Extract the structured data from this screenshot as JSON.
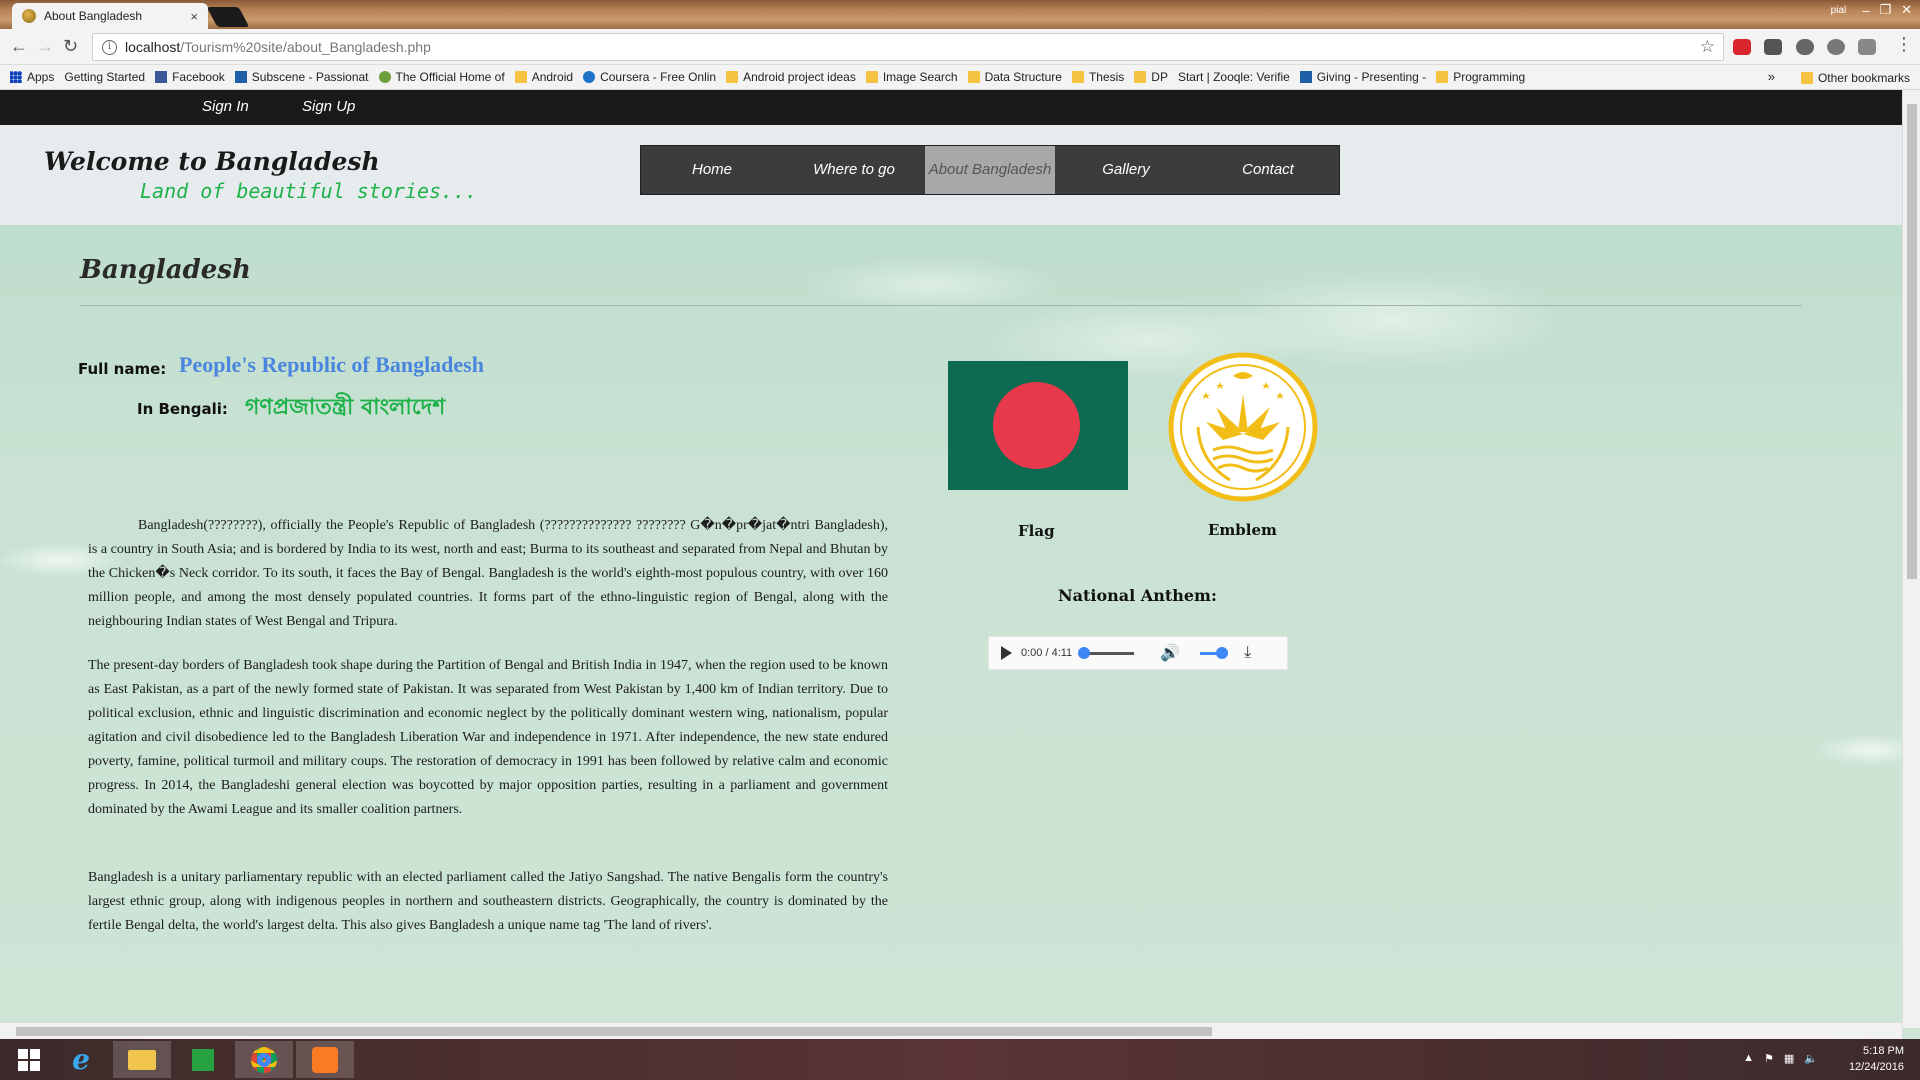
{
  "browser": {
    "tab_title": "About Bangladesh",
    "tab_close": "×",
    "profile": "pial",
    "window_controls": [
      "–",
      "❐",
      "✕"
    ],
    "url_host": "localhost",
    "url_path": "/Tourism%20site/about_Bangladesh.php",
    "bookmarks": [
      {
        "label": "Apps",
        "icon": "grid"
      },
      {
        "label": "Getting Started",
        "icon": "page"
      },
      {
        "label": "Facebook",
        "icon": "fb"
      },
      {
        "label": "Subscene - Passionat",
        "icon": "s"
      },
      {
        "label": "The Official Home of",
        "icon": "gen"
      },
      {
        "label": "Android",
        "icon": "folder"
      },
      {
        "label": "Coursera - Free Onlin",
        "icon": "co"
      },
      {
        "label": "Android project ideas",
        "icon": "folder"
      },
      {
        "label": "Image Search",
        "icon": "folder"
      },
      {
        "label": "Data Structure",
        "icon": "folder"
      },
      {
        "label": "Thesis",
        "icon": "folder"
      },
      {
        "label": "DP",
        "icon": "folder"
      },
      {
        "label": "Start | Zooqle: Verifie",
        "icon": "page"
      },
      {
        "label": "Giving - Presenting -",
        "icon": "s"
      },
      {
        "label": "Programming",
        "icon": "folder"
      }
    ],
    "more_bookmarks": "»",
    "other_bookmarks": "Other bookmarks"
  },
  "site": {
    "auth": {
      "sign_in": "Sign In",
      "sign_up": "Sign Up"
    },
    "title": "Welcome to Bangladesh",
    "tagline": "Land of beautiful stories...",
    "nav": [
      {
        "label": "Home",
        "active": false
      },
      {
        "label": "Where to go",
        "active": false
      },
      {
        "label": "About Bangladesh",
        "active": true
      },
      {
        "label": "Gallery",
        "active": false
      },
      {
        "label": "Contact",
        "active": false
      }
    ]
  },
  "content": {
    "heading": "Bangladesh",
    "full_name_label": "Full name:",
    "full_name": "People's Republic of Bangladesh",
    "bengali_label": "In Bengali:",
    "bengali_name": "গণপ্রজাতন্ত্রী বাংলাদেশ",
    "paragraphs": [
      "Bangladesh(????????), officially the People's Republic of Bangladesh (?????????????? ???????? G�n�pr�jat�ntri Bangladesh), is a country in South Asia; and is bordered by India to its west, north and east; Burma to its southeast and separated from Nepal and Bhutan by the Chicken�s Neck corridor. To its south, it faces the Bay of Bengal. Bangladesh is the world's eighth-most populous country, with over 160 million people, and among the most densely populated countries. It forms part of the ethno-linguistic region of Bengal, along with the neighbouring Indian states of West Bengal and Tripura.",
      "The present-day borders of Bangladesh took shape during the Partition of Bengal and British India in 1947, when the region used to be known as East Pakistan, as a part of the newly formed state of Pakistan. It was separated from West Pakistan by 1,400 km of Indian territory. Due to political exclusion, ethnic and linguistic discrimination and economic neglect by the politically dominant western wing, nationalism, popular agitation and civil disobedience led to the Bangladesh Liberation War and independence in 1971. After independence, the new state endured poverty, famine, political turmoil and military coups. The restoration of democracy in 1991 has been followed by relative calm and economic progress. In 2014, the Bangladeshi general election was boycotted by major opposition parties, resulting in a parliament and government dominated by the Awami League and its smaller coalition partners.",
      "Bangladesh is a unitary parliamentary republic with an elected parliament called the Jatiyo Sangshad. The native Bengalis form the country's largest ethnic group, along with indigenous peoples in northern and southeastern districts. Geographically, the country is dominated by the fertile Bengal delta, the world's largest delta. This also gives Bangladesh a unique name tag 'The land of rivers'."
    ],
    "flag_caption": "Flag",
    "emblem_caption": "Emblem",
    "anthem_label": "National Anthem:",
    "player": {
      "time": "0:00 / 4:11",
      "progress": 0,
      "volume": 0.8
    }
  },
  "taskbar": {
    "time": "5:18 PM",
    "date": "12/24/2016",
    "apps": [
      "windows-start",
      "internet-explorer",
      "file-explorer",
      "store",
      "chrome",
      "xampp"
    ]
  },
  "colors": {
    "flag_green": "#0b6a4f",
    "flag_red": "#e8394c",
    "link_blue": "#4a86de",
    "accent_green": "#1fb24a"
  }
}
